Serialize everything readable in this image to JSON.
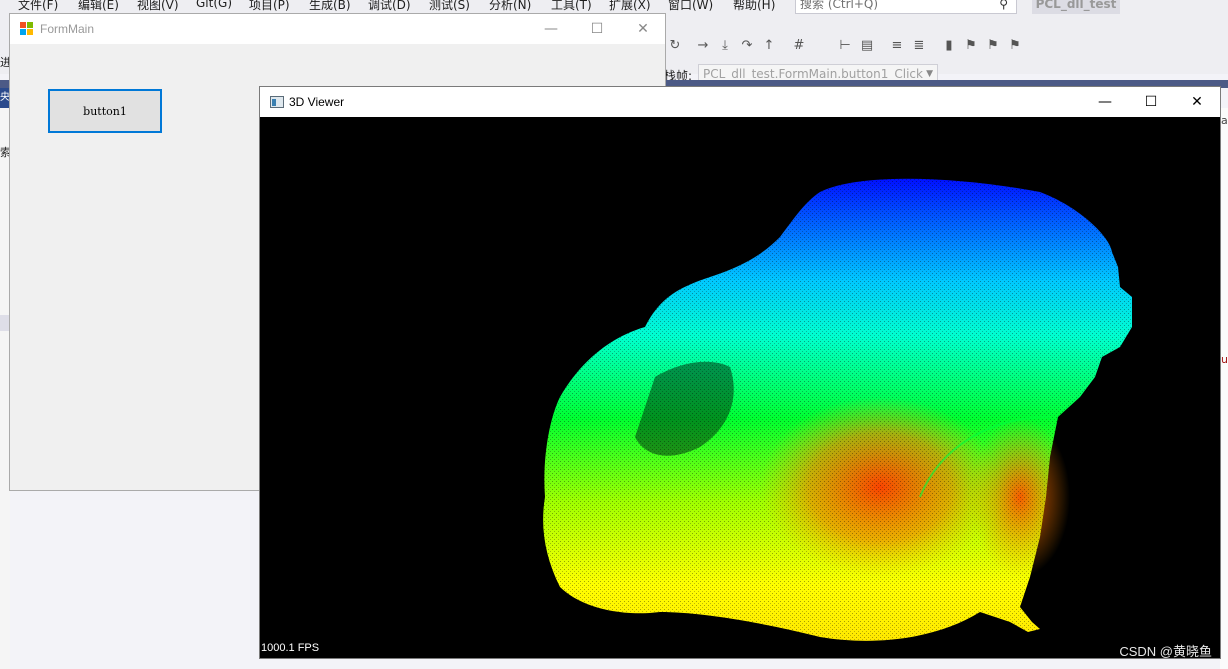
{
  "vs": {
    "menu": [
      "文件(F)",
      "编辑(E)",
      "视图(V)",
      "Git(G)",
      "项目(P)",
      "生成(B)",
      "调试(D)",
      "测试(S)",
      "分析(N)",
      "工具(T)",
      "扩展(X)",
      "窗口(W)",
      "帮助(H)"
    ],
    "search_placeholder": "搜索 (Ctrl+Q)",
    "project_name": "PCL_dll_test",
    "stack_frame_label": "栈帧:",
    "stack_frame_value": "PCL_dll_test.FormMain.button1_Click",
    "left_partial_1": "进",
    "left_partial_2": "央",
    "left_partial_3": "索",
    "right_partial_1": "a",
    "right_partial_2": "u"
  },
  "formmain": {
    "title": "FormMain",
    "button_label": "button1",
    "minimize": "—",
    "maximize": "☐",
    "close": "✕"
  },
  "viewer": {
    "title": "3D Viewer",
    "fps": "1000.1 FPS",
    "watermark": "CSDN @黄晓鱼",
    "minimize": "—",
    "maximize": "☐",
    "close": "✕"
  },
  "colors": {
    "viewer_bg": "#000000",
    "button_border": "#0078d7",
    "vs_dark_bar": "#4c5a86",
    "pointcloud_top": "#0000ff",
    "pointcloud_mid": "#00ff00",
    "pointcloud_bottom": "#ffff00",
    "pointcloud_hot": "#ff3000"
  }
}
